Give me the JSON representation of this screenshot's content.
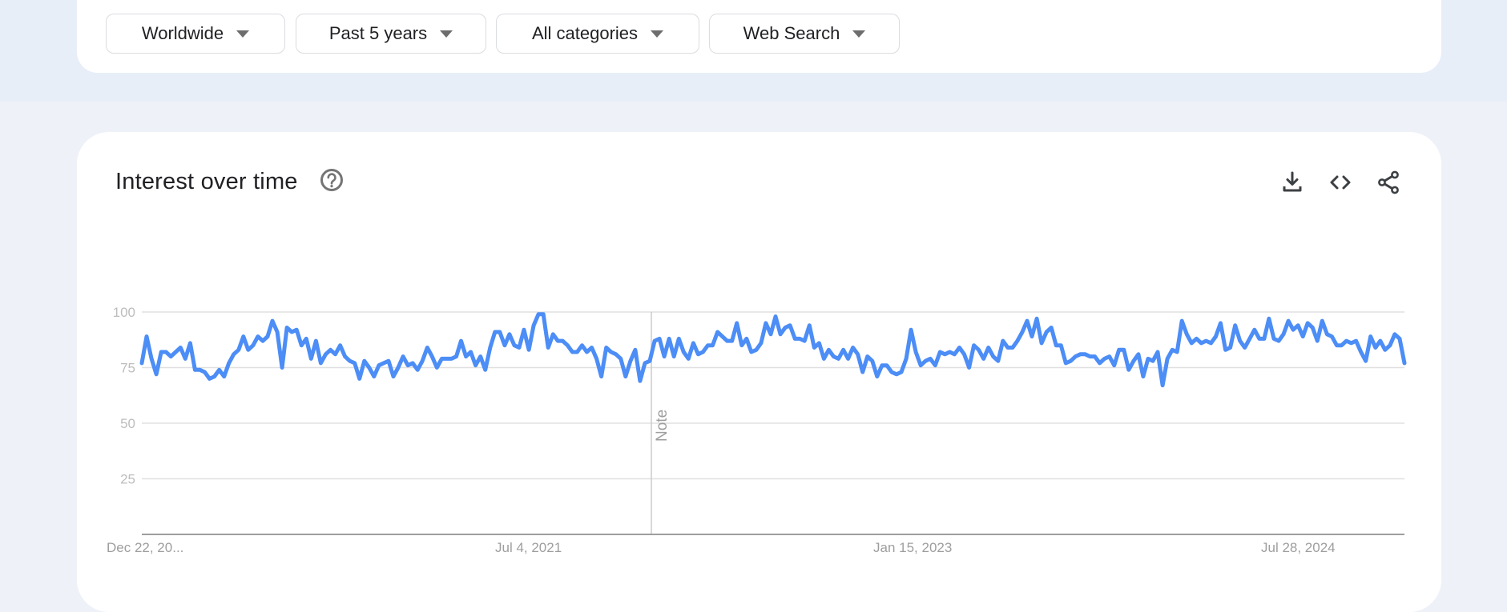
{
  "filters": {
    "region": "Worldwide",
    "time_range": "Past 5 years",
    "category": "All categories",
    "search_type": "Web Search"
  },
  "card": {
    "title": "Interest over time",
    "icons": [
      "help-icon",
      "download-icon",
      "embed-code-icon",
      "share-icon"
    ]
  },
  "colors": {
    "series": "#4c8df6",
    "gridline": "#e0e0e0",
    "axis_text": "#9e9e9e",
    "note_line": "#cccccc"
  },
  "chart_data": {
    "type": "line",
    "title": "Interest over time",
    "xlabel": "",
    "ylabel": "",
    "ylim": [
      0,
      100
    ],
    "yticks": [
      25,
      50,
      75,
      100
    ],
    "grid": true,
    "x_tick_labels": [
      "Dec 22, 20...",
      "Jul 4, 2021",
      "Jan 15, 2023",
      "Jul 28, 2024"
    ],
    "x_tick_positions": [
      0,
      80,
      160,
      240
    ],
    "annotation": {
      "label": "Note",
      "index": 130
    },
    "series": [
      {
        "name": "Interest",
        "values": [
          77,
          89,
          79,
          72,
          82,
          82,
          80,
          82,
          84,
          79,
          86,
          74,
          74,
          73,
          70,
          71,
          74,
          71,
          77,
          81,
          83,
          89,
          83,
          85,
          89,
          87,
          89,
          96,
          91,
          75,
          93,
          91,
          92,
          85,
          88,
          79,
          87,
          77,
          81,
          83,
          81,
          85,
          80,
          78,
          77,
          70,
          78,
          75,
          71,
          76,
          77,
          78,
          71,
          75,
          80,
          76,
          77,
          74,
          78,
          84,
          80,
          75,
          79,
          79,
          79,
          80,
          87,
          80,
          82,
          76,
          80,
          74,
          84,
          91,
          91,
          85,
          90,
          85,
          84,
          92,
          83,
          94,
          99,
          99,
          84,
          90,
          87,
          87,
          85,
          82,
          82,
          85,
          82,
          84,
          79,
          71,
          84,
          82,
          81,
          79,
          71,
          78,
          83,
          69,
          77,
          78,
          87,
          88,
          80,
          88,
          80,
          88,
          82,
          79,
          86,
          81,
          82,
          85,
          85,
          91,
          89,
          87,
          87,
          95,
          85,
          88,
          82,
          83,
          86,
          95,
          90,
          98,
          90,
          93,
          94,
          88,
          88,
          87,
          94,
          84,
          86,
          79,
          83,
          80,
          79,
          83,
          79,
          84,
          81,
          73,
          80,
          78,
          71,
          76,
          76,
          73,
          72,
          73,
          79,
          92,
          82,
          76,
          78,
          79,
          76,
          82,
          81,
          82,
          81,
          84,
          81,
          75,
          85,
          83,
          79,
          84,
          80,
          78,
          87,
          84,
          84,
          87,
          91,
          96,
          89,
          97,
          86,
          91,
          93,
          85,
          85,
          77,
          78,
          80,
          81,
          81,
          80,
          80,
          77,
          79,
          80,
          76,
          83,
          83,
          74,
          78,
          81,
          71,
          79,
          78,
          82,
          67,
          79,
          83,
          82,
          96,
          90,
          86,
          88,
          86,
          87,
          86,
          89,
          95,
          83,
          84,
          94,
          87,
          84,
          88,
          92,
          88,
          88,
          97,
          88,
          87,
          90,
          96,
          92,
          94,
          89,
          95,
          93,
          87,
          96,
          90,
          89,
          85,
          85,
          87,
          86,
          87,
          82,
          78,
          89,
          84,
          87,
          83,
          85,
          90,
          88,
          77
        ]
      }
    ]
  }
}
